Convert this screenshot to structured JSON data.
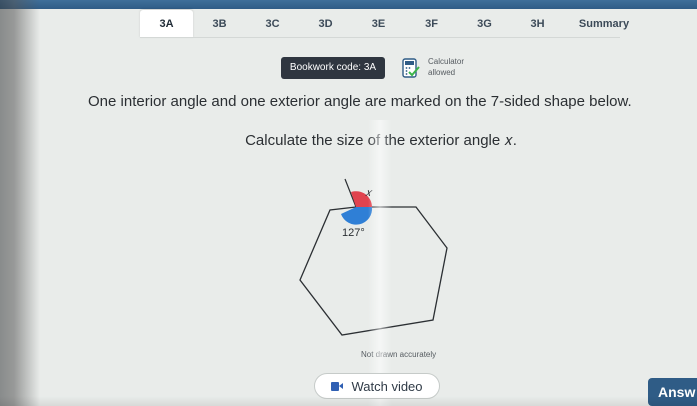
{
  "tabs": [
    {
      "label": "3A",
      "active": true
    },
    {
      "label": "3B",
      "active": false
    },
    {
      "label": "3C",
      "active": false
    },
    {
      "label": "3D",
      "active": false
    },
    {
      "label": "3E",
      "active": false
    },
    {
      "label": "3F",
      "active": false
    },
    {
      "label": "3G",
      "active": false
    },
    {
      "label": "3H",
      "active": false
    },
    {
      "label": "Summary",
      "active": false
    }
  ],
  "bookwork": {
    "label": "Bookwork code: 3A"
  },
  "calculator": {
    "line1": "Calculator",
    "line2": "allowed",
    "icon": "calculator-icon"
  },
  "question": {
    "text": "One interior angle and one exterior angle are marked on the 7-sided shape below.",
    "instruction": "Calculate the size of the exterior angle 𝑥."
  },
  "diagram": {
    "interior_angle_label": "127°",
    "exterior_angle_label": "𝑥",
    "note": "Not drawn accurately",
    "interior_color": "#2f7fd6",
    "exterior_color": "#e0434f",
    "sides": 7
  },
  "buttons": {
    "watch_video": "Watch video",
    "answer": "Answ"
  },
  "colors": {
    "accent": "#2f5c86",
    "badge": "#2f3640"
  }
}
